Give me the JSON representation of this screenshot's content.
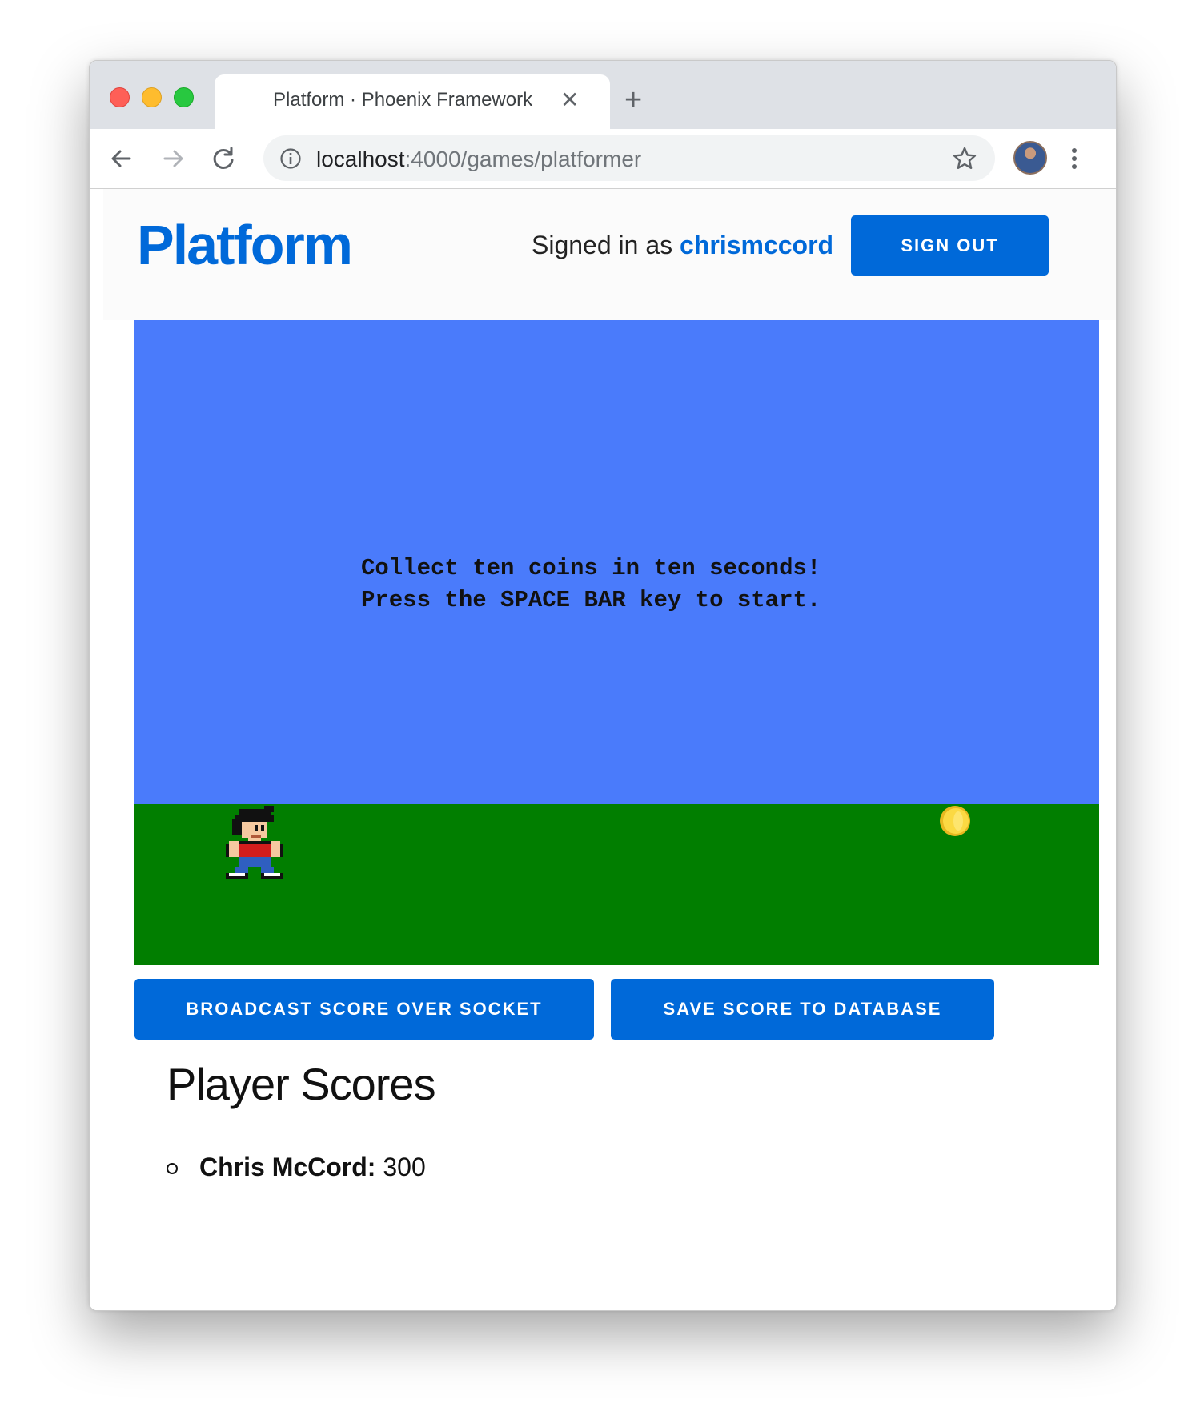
{
  "browser": {
    "tab_title": "Platform · Phoenix Framework",
    "tab_close": "✕",
    "new_tab": "+",
    "url_host": "localhost",
    "url_path": ":4000/games/platformer"
  },
  "header": {
    "logo": "Platform",
    "signed_in_prefix": "Signed in as ",
    "username": "chrismccord",
    "sign_out_label": "SIGN OUT"
  },
  "game": {
    "message_line1": "Collect ten coins in ten seconds!",
    "message_line2": "Press the SPACE BAR key to start.",
    "sky_color": "#4a7bfb",
    "ground_color": "#017e00",
    "player_icon": "player-sprite",
    "coin_icon": "coin-icon"
  },
  "actions": {
    "broadcast_label": "BROADCAST SCORE OVER SOCKET",
    "save_label": "SAVE SCORE TO DATABASE"
  },
  "scores": {
    "heading": "Player Scores",
    "items": [
      {
        "name": "Chris McCord:",
        "score": "300"
      }
    ]
  },
  "colors": {
    "accent": "#0069d9"
  }
}
